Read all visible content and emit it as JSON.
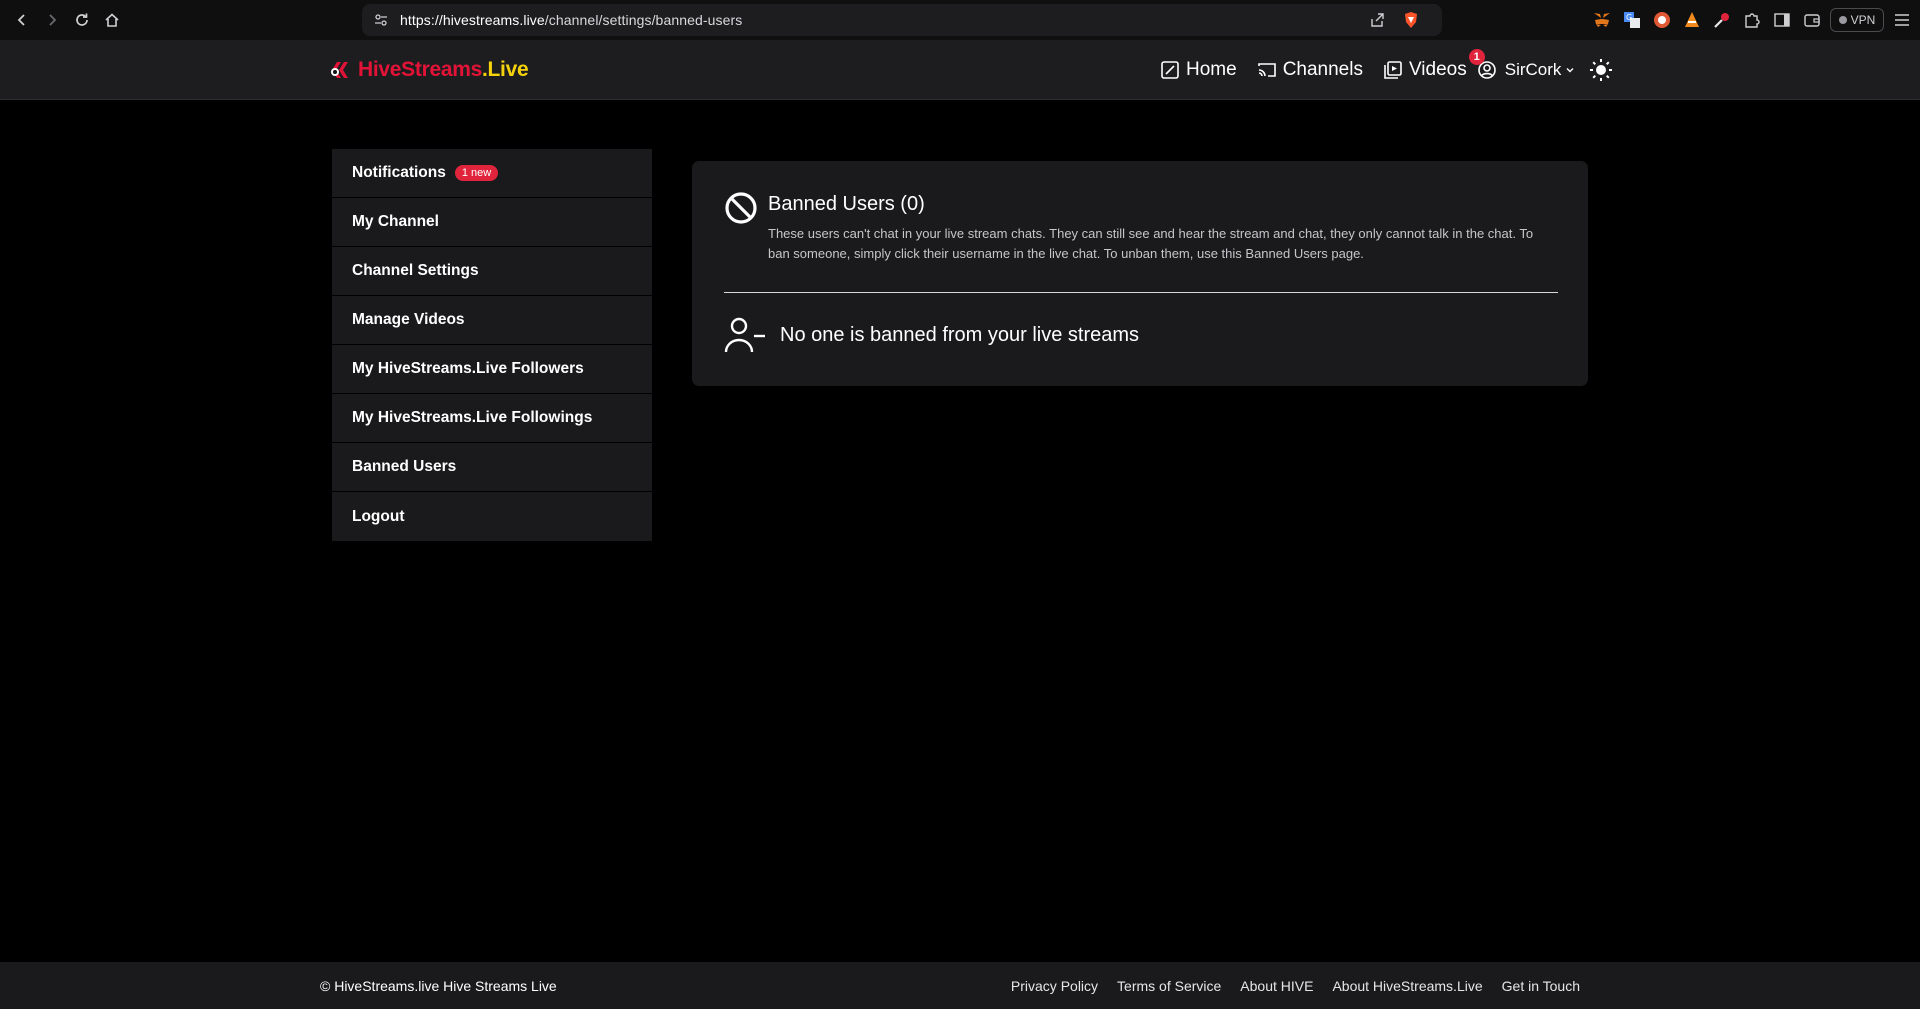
{
  "browser": {
    "url_host": "https://hivestreams.live",
    "url_path": "/channel/settings/banned-users",
    "vpn_label": "VPN"
  },
  "header": {
    "logo_hive": "Hive",
    "logo_streams": "Streams",
    "logo_live": ".Live",
    "nav": {
      "home": "Home",
      "channels": "Channels",
      "videos": "Videos"
    },
    "user": {
      "name": "SirCork",
      "notification_count": "1"
    }
  },
  "sidebar": {
    "items": [
      {
        "label": "Notifications",
        "badge": "1 new"
      },
      {
        "label": "My Channel"
      },
      {
        "label": "Channel Settings"
      },
      {
        "label": "Manage Videos"
      },
      {
        "label": "My HiveStreams.Live Followers"
      },
      {
        "label": "My HiveStreams.Live Followings"
      },
      {
        "label": "Banned Users"
      },
      {
        "label": "Logout"
      }
    ]
  },
  "main": {
    "title": "Banned Users (0)",
    "description": "These users can't chat in your live stream chats. They can still see and hear the stream and chat, they only cannot talk in the chat. To ban someone, simply click their username in the live chat. To unban them, use this Banned Users page.",
    "empty_message": "No one is banned from your live streams"
  },
  "footer": {
    "copyright": "© HiveStreams.live Hive Streams Live",
    "links": [
      "Privacy Policy",
      "Terms of Service",
      "About HIVE",
      "About HiveStreams.Live",
      "Get in Touch"
    ]
  },
  "colors": {
    "accent_red": "#e0243c",
    "hive_red": "#e31337",
    "live_yellow": "#f5d20b",
    "panel": "#1a1a1c"
  }
}
